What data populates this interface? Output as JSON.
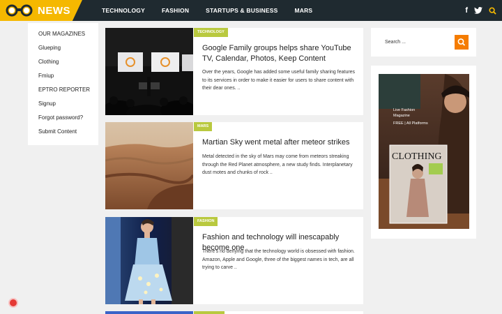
{
  "brand": {
    "name": "NEWS",
    "color": "#f5b800"
  },
  "nav": [
    "TECHNOLOGY",
    "FASHION",
    "STARTUPS & BUSINESS",
    "MARS"
  ],
  "social": {
    "facebook": "f",
    "twitter": "t"
  },
  "left_menu": [
    "OUR MAGAZINES",
    "Glueping",
    "Clothing",
    "Fmiup",
    "EPTRO REPORTER",
    "Signup",
    "Forgot password?",
    "Submit Content"
  ],
  "articles": [
    {
      "category": "TECHNOLOGY",
      "title": "Google Family groups helps share YouTube TV, Calendar, Photos, Keep Content",
      "excerpt": "Over the years, Google has added some useful family sharing features to its services in order to make it easier for users to share content with their dear ones. .."
    },
    {
      "category": "MARS",
      "title": "Martian Sky went metal after meteor strikes",
      "excerpt": "Metal detected in the sky of Mars may come from meteors streaking through the Red Planet atmosphere, a new study finds. Interplanetary dust motes and chunks of rock .."
    },
    {
      "category": "FASHION",
      "title": "Fashion and technology will inescapably become one",
      "excerpt": "There's no denying that the technology world is obsessed with fashion. Amazon, Apple and Google, three of the biggest names in tech, are all trying to carve .."
    }
  ],
  "search": {
    "placeholder": "Search ..."
  },
  "ad": {
    "line1": "Live Fashion",
    "line2": "Magazine",
    "line3": "FREE | All Platforms",
    "cover": "CLOTHING"
  }
}
